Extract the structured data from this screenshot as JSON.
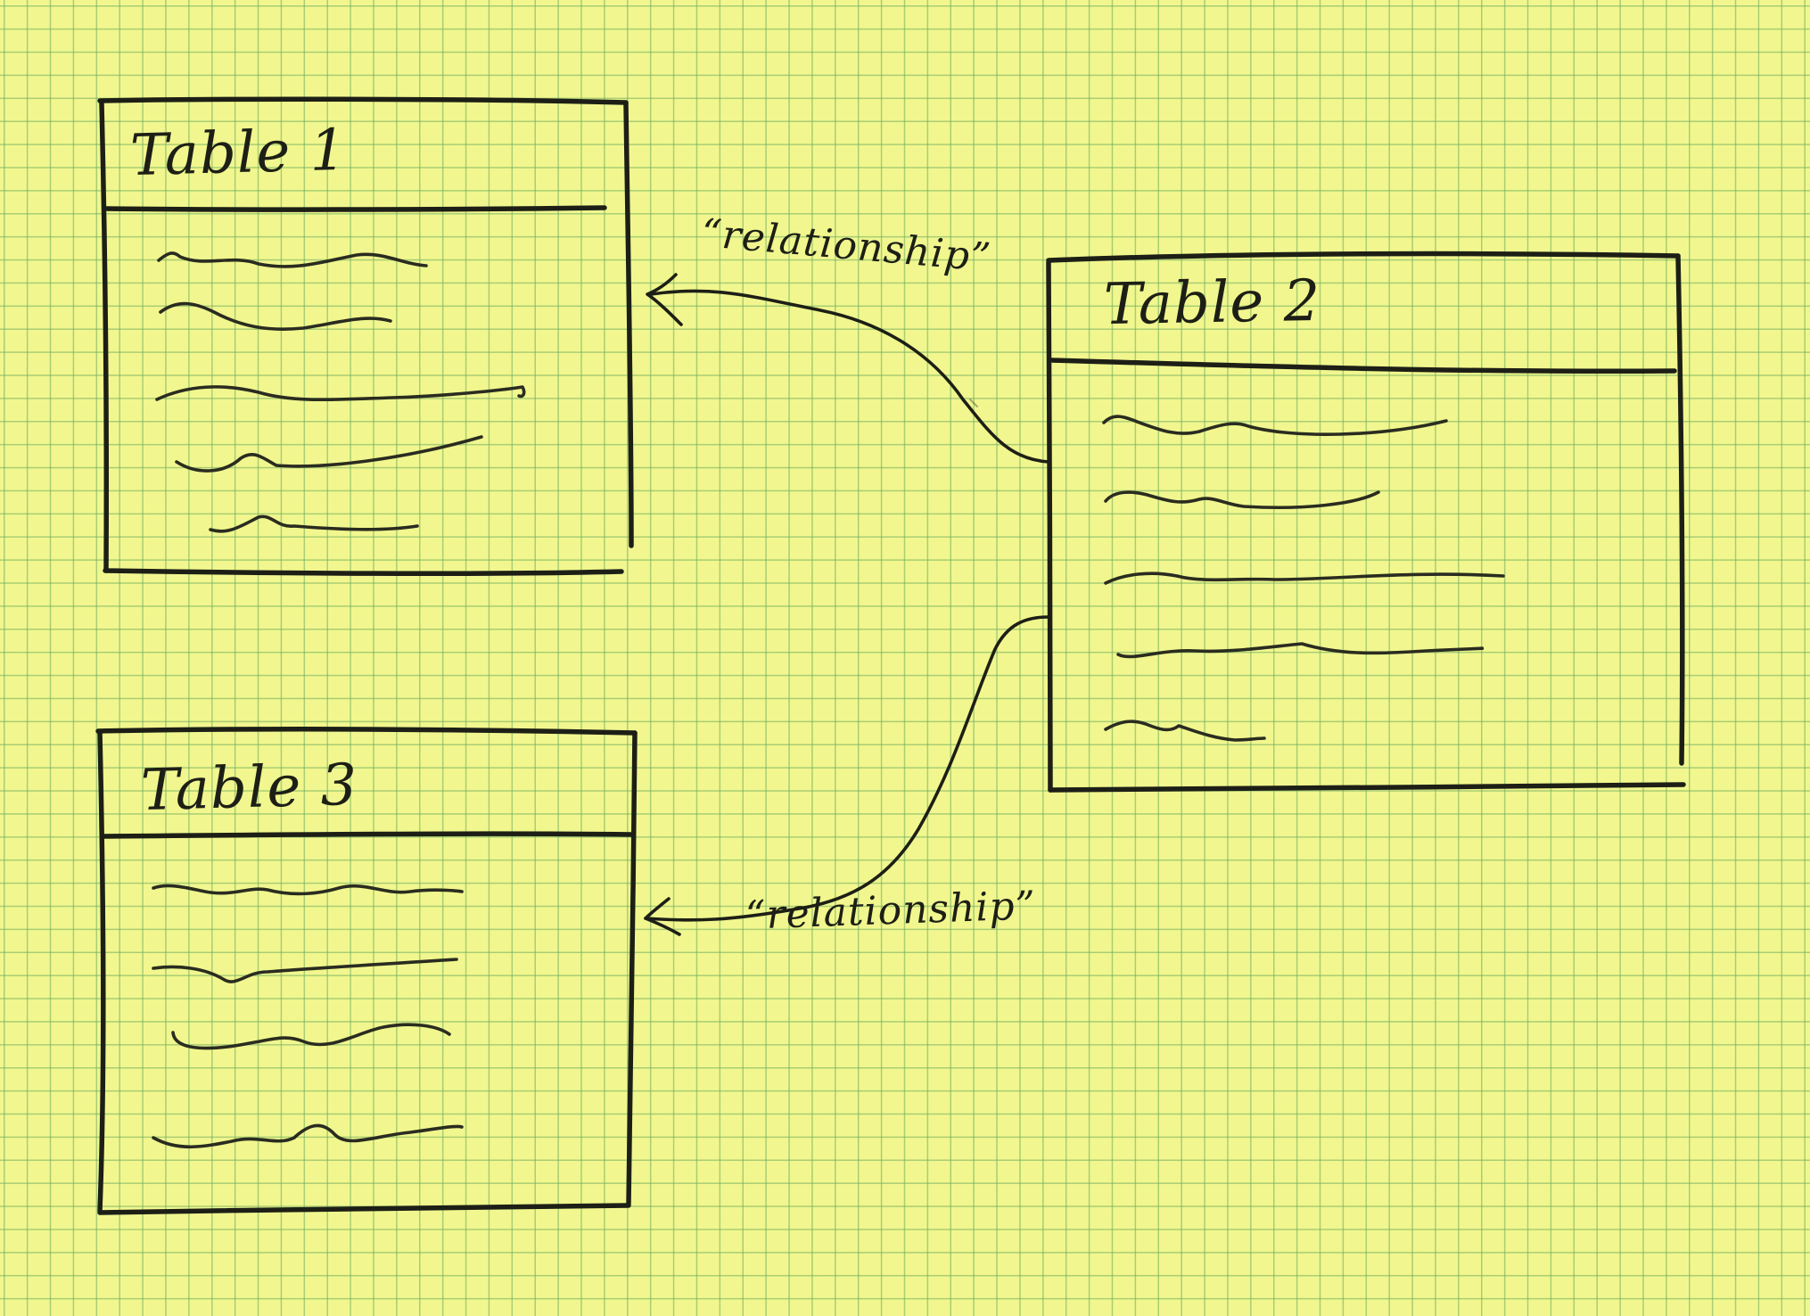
{
  "diagram": {
    "tables": [
      {
        "id": "table-1",
        "title": "Table 1"
      },
      {
        "id": "table-2",
        "title": "Table 2"
      },
      {
        "id": "table-3",
        "title": "Table 3"
      }
    ],
    "relationships": [
      {
        "from": "Table 2",
        "to": "Table 1",
        "label": "“relationship”"
      },
      {
        "from": "Table 2",
        "to": "Table 3",
        "label": "“relationship”"
      }
    ]
  },
  "colors": {
    "paper": "#f1f78e",
    "grid": "#6eaa5f",
    "ink": "#1d1f16"
  }
}
